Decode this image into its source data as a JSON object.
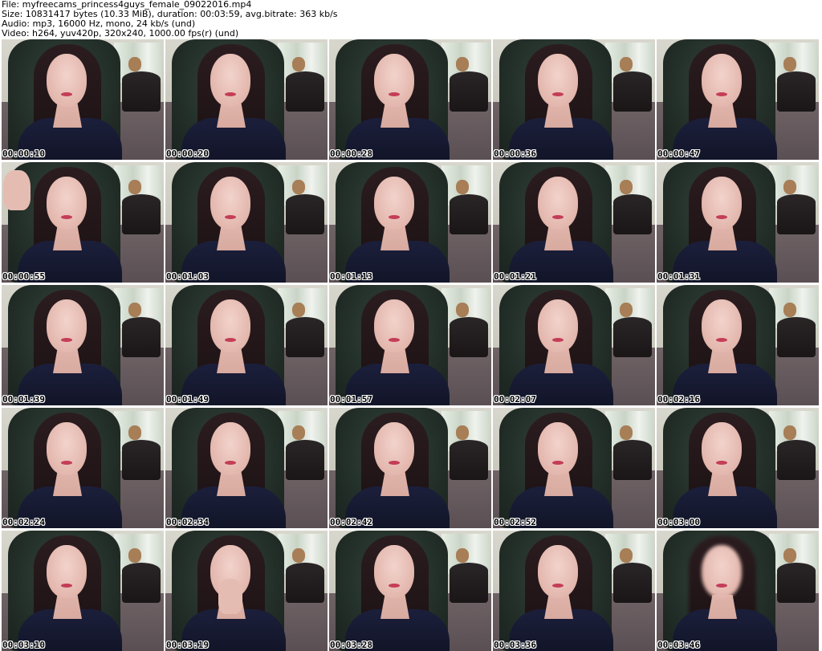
{
  "header": {
    "file": "File: myfreecams_princess4guys_female_09022016.mp4",
    "size": "Size: 10831417 bytes (10.33 MiB), duration: 00:03:59, avg.bitrate: 363 kb/s",
    "audio": "Audio: mp3, 16000 Hz, mono, 24 kb/s (und)",
    "video": "Video: h264, yuv420p, 320x240, 1000.00 fps(r) (und)"
  },
  "thumbnails": [
    {
      "timestamp": "00:00:10"
    },
    {
      "timestamp": "00:00:20"
    },
    {
      "timestamp": "00:00:28"
    },
    {
      "timestamp": "00:00:36"
    },
    {
      "timestamp": "00:00:47"
    },
    {
      "timestamp": "00:00:55"
    },
    {
      "timestamp": "00:01:03"
    },
    {
      "timestamp": "00:01:13"
    },
    {
      "timestamp": "00:01:21"
    },
    {
      "timestamp": "00:01:31"
    },
    {
      "timestamp": "00:01:39"
    },
    {
      "timestamp": "00:01:49"
    },
    {
      "timestamp": "00:01:57"
    },
    {
      "timestamp": "00:02:07"
    },
    {
      "timestamp": "00:02:16"
    },
    {
      "timestamp": "00:02:24"
    },
    {
      "timestamp": "00:02:34"
    },
    {
      "timestamp": "00:02:42"
    },
    {
      "timestamp": "00:02:52"
    },
    {
      "timestamp": "00:03:00"
    },
    {
      "timestamp": "00:03:10"
    },
    {
      "timestamp": "00:03:19"
    },
    {
      "timestamp": "00:03:28"
    },
    {
      "timestamp": "00:03:36"
    },
    {
      "timestamp": "00:03:46"
    }
  ]
}
